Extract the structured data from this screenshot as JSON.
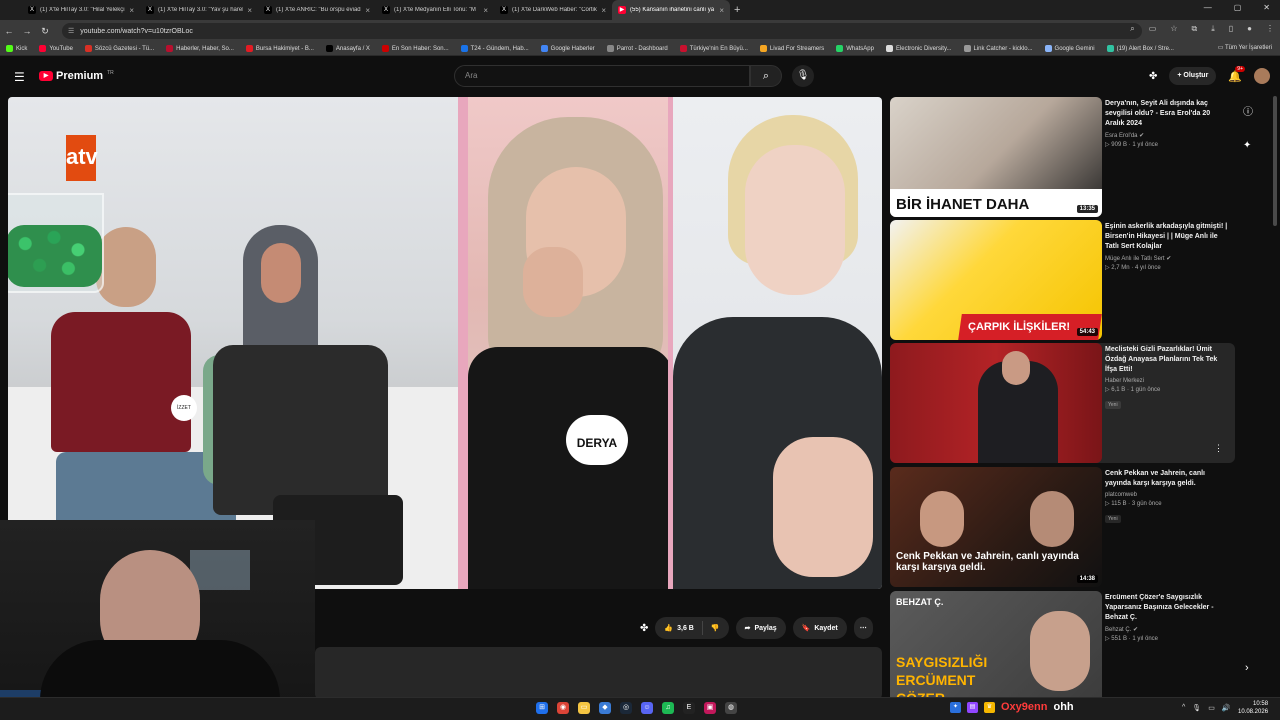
{
  "browser": {
    "tabs": [
      {
        "label": "(1) X'te HilTay 3.0: \"Hilal Yelekçi",
        "icon": "x-icon"
      },
      {
        "label": "(1) X'te HilTay 3.0: \"Yav şu hareli",
        "icon": "x-icon"
      },
      {
        "label": "(1) X'te ANRIC: \"Bu orspu eviad",
        "icon": "x-icon"
      },
      {
        "label": "(1) X'te Medyanın Elli Tonu: \"M",
        "icon": "x-icon"
      },
      {
        "label": "(1) X'te DarkWeb Haber: \"Cortik",
        "icon": "x-icon"
      },
      {
        "label": "(55) Kansanın ihanetini canlı ya",
        "icon": "youtube-icon",
        "active": true
      }
    ],
    "new_tab": "+",
    "url": "youtube.com/watch?v=u10tzrOBLoc",
    "bookmarks": [
      "Kick",
      "YouTube",
      "Sözcü Gazetesi - Tü...",
      "Haberler, Haber, So...",
      "Bursa Hakimiyet - B...",
      "Anasayfa / X",
      "En Son Haber: Son...",
      "T24 - Gündem, Hab...",
      "Google Haberler",
      "Parrot - Dashboard",
      "Türkiye'nin En Büyü...",
      "Livad For Streamers",
      "WhatsApp",
      "Electronic Diversity...",
      "Link Catcher - kicklo...",
      "Google Gemini",
      "(19) Alert Box / Stre..."
    ],
    "all_bookmarks": "Tüm Yer İşaretleri"
  },
  "youtube": {
    "logo": "Premium",
    "logo_region": "TR",
    "search_placeholder": "Ara",
    "create_label": "Oluştur",
    "notif_badge": "9+"
  },
  "video": {
    "channel_logo": "atv",
    "girl_tag": "DERYA",
    "man_tag": "İZZET",
    "likes": "3,6 B",
    "share": "Paylaş",
    "save": "Kaydet"
  },
  "recommendations": [
    {
      "title": "Derya'nın, Seyit Ali dışında kaç sevgilisi oldu? - Esra Erol'da 20 Aralık 2024",
      "channel": "Esra Erol'da",
      "verified": true,
      "views": "909 B",
      "age": "1 yıl önce",
      "duration": "13:35",
      "caption": "BİR İHANET DAHA",
      "new": ""
    },
    {
      "title": "Eşinin askerlik arkadaşıyla gitmişti! | Birsen'in Hikayesi | | Müge Anlı ile Tatlı Sert Kolajlar",
      "channel": "Müge Anlı ile Tatlı Sert",
      "verified": true,
      "views": "2,7 Mn",
      "age": "4 yıl önce",
      "duration": "54:43",
      "caption": "ÇARPIK İLİŞKİLER!",
      "new": ""
    },
    {
      "title": "Meclisteki Gizli Pazarlıklar! Ümit Özdağ Anayasa Planlarını Tek Tek İfşa Etti!",
      "channel": "Haber Merkezi",
      "verified": false,
      "views": "6,1 B",
      "age": "1 gün önce",
      "duration": "",
      "caption": "",
      "new": "Yeni"
    },
    {
      "title": "Cenk Pekkan ve Jahrein, canlı yayında karşı karşıya geldi.",
      "channel": "platcomweb",
      "verified": false,
      "views": "115 B",
      "age": "3 gün önce",
      "duration": "14:38",
      "caption": "Cenk Pekkan ve Jahrein, canlı yayında karşı karşıya geldi.",
      "new": "Yeni"
    },
    {
      "title": "Ercüment Çözer'e Saygısızlık Yaparsanız Başınıza Gelecekler - Behzat Ç.",
      "channel": "Behzat Ç.",
      "verified": true,
      "views": "551 B",
      "age": "1 yıl önce",
      "duration": "",
      "caption": "SAYGISIZLIĞI ERCÜMENT ÇÖZER",
      "thumb_tag": "BEHZAT Ç.",
      "new": ""
    }
  ],
  "taskbar": {
    "streamer": "Oxy9enn",
    "message": "ohh",
    "time": "10:58",
    "date": "10.08.2026"
  },
  "colors": {
    "accent": "#ff0033",
    "background": "#0f0f0f",
    "streamer_name": "#ff3b3b"
  }
}
